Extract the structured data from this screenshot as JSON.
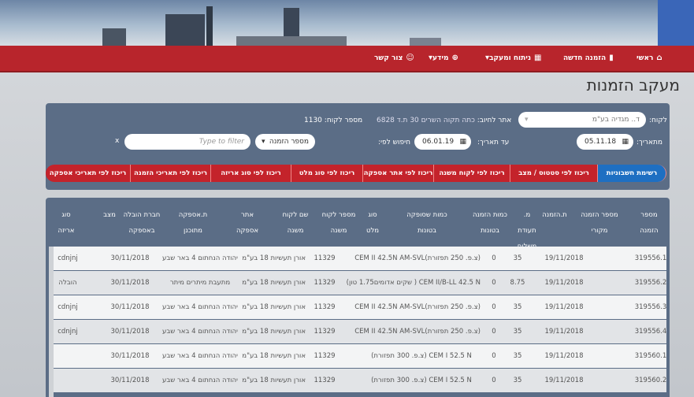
{
  "nav": {
    "home": "ראשי",
    "new_order": "הזמנה חדשה",
    "tracking": "ניתוח ומעקב",
    "info": "מידע",
    "contact": "צור קשר"
  },
  "page_title": "מעקב הזמנות",
  "filters": {
    "customer_label": "לקוח:",
    "customer_value": "ד.. מגדיה בע\"מ",
    "site_label": "אתר לחיוב:",
    "site_value": "כתה תקוה השרים 30 ת.ד 6828",
    "customer_num_label": "מספר לקוח:",
    "customer_num_value": "1130",
    "from_label": "מתאריך:",
    "from_value": "05.11.18",
    "to_label": "עד תאריך:",
    "to_value": "06.01.19",
    "search_label": "חיפוש לפי:",
    "search_select": "מספר הזמנה",
    "search_placeholder": "Type to filter",
    "clear": "x"
  },
  "tabs": [
    "רשימת חשבוניות",
    "ריכוז לפי סטטוס / מצב",
    "ריכוז לפי לקוח משנה",
    "ריכוז לפי אתר אספקה",
    "ריכוז לפי סוג מלט",
    "ריכוז לפי סוג אריזה",
    "ריכוז לפי תאריכי הזמנה",
    "ריכוז לפי תאריכי אספקה"
  ],
  "columns": [
    [
      "מספר",
      "הזמנה"
    ],
    [
      "מספר הזמנה",
      "מקורי"
    ],
    [
      "ת.הזמנה",
      ""
    ],
    [
      "מ. תעודת",
      "משלוח"
    ],
    [
      "כמות הזמנה",
      "בטונות"
    ],
    [
      "כמות שסופקה",
      "בטונות"
    ],
    [
      "סוג",
      "מלט"
    ],
    [
      "מספר לקוח",
      "משנה"
    ],
    [
      "שם לקוח",
      "משנה"
    ],
    [
      "אתר",
      "אספקה"
    ],
    [
      "ת.אספקה",
      "מתוכנן"
    ],
    [
      "חברת הובלה",
      "באספקה"
    ],
    [
      "מצב",
      ""
    ],
    [
      "סוג",
      "אריזה"
    ]
  ],
  "rows": [
    {
      "order": "319556.1",
      "date": "19/11/2018",
      "qty": "35",
      "delivered": "0",
      "cement": "(צ.פ. 250 תפזורת)CEM II 42.5N AM-SVL",
      "sub_num": "11329",
      "sub_name": "אורן תעשיות 18 בע\"מ",
      "site": "יהודה הנחתום 4 באר שבע",
      "planned": "30/11/2018",
      "status": "",
      "package": "cdnjnj"
    },
    {
      "order": "319556.2",
      "date": "19/11/2018",
      "qty": "8.75",
      "delivered": "0",
      "cement": "CEM II/B-LL 42.5 N ( שקים אדומים1.75 טון)",
      "sub_num": "11329",
      "sub_name": "אורן תעשיות 18 בע\"מ",
      "site": "מתעבת מיתרים מיתר",
      "planned": "30/11/2018",
      "status": "",
      "package": "הובלה"
    },
    {
      "order": "319556.3",
      "date": "19/11/2018",
      "qty": "35",
      "delivered": "0",
      "cement": "(צ.פ. 250 תפזורת)CEM II 42.5N AM-SVL",
      "sub_num": "11329",
      "sub_name": "אורן תעשיות 18 בע\"מ",
      "site": "יהודה הנחתום 4 באר שבע",
      "planned": "30/11/2018",
      "status": "",
      "package": "cdnjnj"
    },
    {
      "order": "319556.4",
      "date": "19/11/2018",
      "qty": "35",
      "delivered": "0",
      "cement": "(צ.פ. 250 תפזורת)CEM II 42.5N AM-SVL",
      "sub_num": "11329",
      "sub_name": "אורן תעשיות 18 בע\"מ",
      "site": "יהודה הנחתום 4 באר שבע",
      "planned": "30/11/2018",
      "status": "",
      "package": "cdnjnj"
    },
    {
      "order": "319560.1",
      "date": "19/11/2018",
      "qty": "35",
      "delivered": "0",
      "cement": "CEM I 52.5 N (צ.פ. 300 תפזורת)",
      "sub_num": "11329",
      "sub_name": "אורן תעשיות 18 בע\"מ",
      "site": "יהודה הנחתום 4 באר שבע",
      "planned": "30/11/2018",
      "status": "",
      "package": ""
    },
    {
      "order": "319560.2",
      "date": "19/11/2018",
      "qty": "35",
      "delivered": "0",
      "cement": "CEM I 52.5 N (צ.פ. 300 תפזורת)",
      "sub_num": "11329",
      "sub_name": "אורן תעשיות 18 בע\"מ",
      "site": "יהודה הנחתום 4 באר שבע",
      "planned": "30/11/2018",
      "status": "",
      "package": ""
    }
  ],
  "colors": {
    "nav_red": "#b8252c",
    "panel": "#5b6d86",
    "tab_blue": "#1e6fc2",
    "tab_red": "#c4232b"
  }
}
